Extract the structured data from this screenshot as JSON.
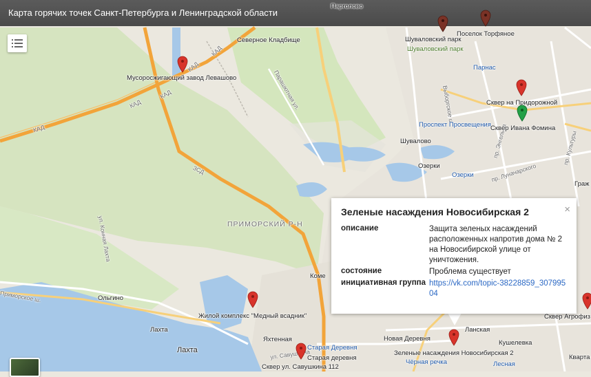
{
  "header": {
    "title": "Карта горячих точек Санкт-Петербурга и Ленинградской области"
  },
  "legend_button": {
    "icon": "list-icon"
  },
  "colors": {
    "pin_red": "#d8342b",
    "pin_dark": "#7a3226",
    "pin_green": "#23a047",
    "road_orange": "#f2a43a",
    "water": "#a6c8e8",
    "park": "#c8dfb0"
  },
  "map_labels": {
    "pargolovo": "Парголово",
    "severnoe": "Северное Кладбище",
    "shuvalovsky_park": "Шуваловский парк",
    "shuvalovsky_park2": "Шуваловский парк",
    "torfyanoe": "Поселок Торфяное",
    "parnas": "Парнас",
    "musor": "Мусоросжигающий завод Левашово",
    "kad1": "КАД",
    "kad2": "КАД",
    "kad3": "КАД",
    "kad4": "КАД",
    "kad5": "КАД",
    "zsd": "ЗСД",
    "parashyutnaya": "Парашютная ул.",
    "vyborgskoe": "Выборгское ш.",
    "engelsa": "пр. Энгельса",
    "lunacharskogo": "пр. Луначарского",
    "kultury": "пр. Культуры",
    "skver_prid": "Сквер на Придорожной",
    "prosvescheniya": "Проспект Просвещения",
    "skver_fomina": "Сквер Ивана Фомина",
    "shuvalovo": "Шувалово",
    "ozerki": "Озерки",
    "ozerki_metro": "Озерки",
    "primorsky": "ПРИМОРСКИЙ Р-Н",
    "konnaya": "ул. Конная Лахта",
    "primorskoe": "Приморское ш.",
    "olgino": "Ольгино",
    "lakhta1": "Лахта",
    "lakhta2": "Лахта",
    "medny": "Жилой комплекс \"Медный всадник\"",
    "yakhtennaya": "Яхтенная",
    "staraya1": "Старая Деревня",
    "staraya2": "Старая деревня",
    "savushkina": "ул. Савушкина",
    "skver_sav": "Сквер ул. Савушкина 112",
    "novaya": "Новая Деревня",
    "zel_nas": "Зеленые насаждения Новосибирская 2",
    "lanskaya": "Ланская",
    "kushelevka": "Кушелевка",
    "chernaya": "Чёрная речка",
    "lesnaya": "Лесная",
    "skver_agrof": "Сквер Агрофиз",
    "kvart": "Кварта",
    "grazh": "Граж",
    "komen": "Коме"
  },
  "popup": {
    "title": "Зеленые насаждения Новосибирская 2",
    "close": "×",
    "rows": [
      {
        "key": "описание",
        "value": "Защита зеленых насаждений расположенных напротив дома № 2 на Новосибирской улице от уничтожения."
      },
      {
        "key": "состояние",
        "value": "Проблема существует"
      },
      {
        "key": "инициативная группа",
        "value": "https://vk.com/topic-38228859_30799504"
      }
    ]
  }
}
